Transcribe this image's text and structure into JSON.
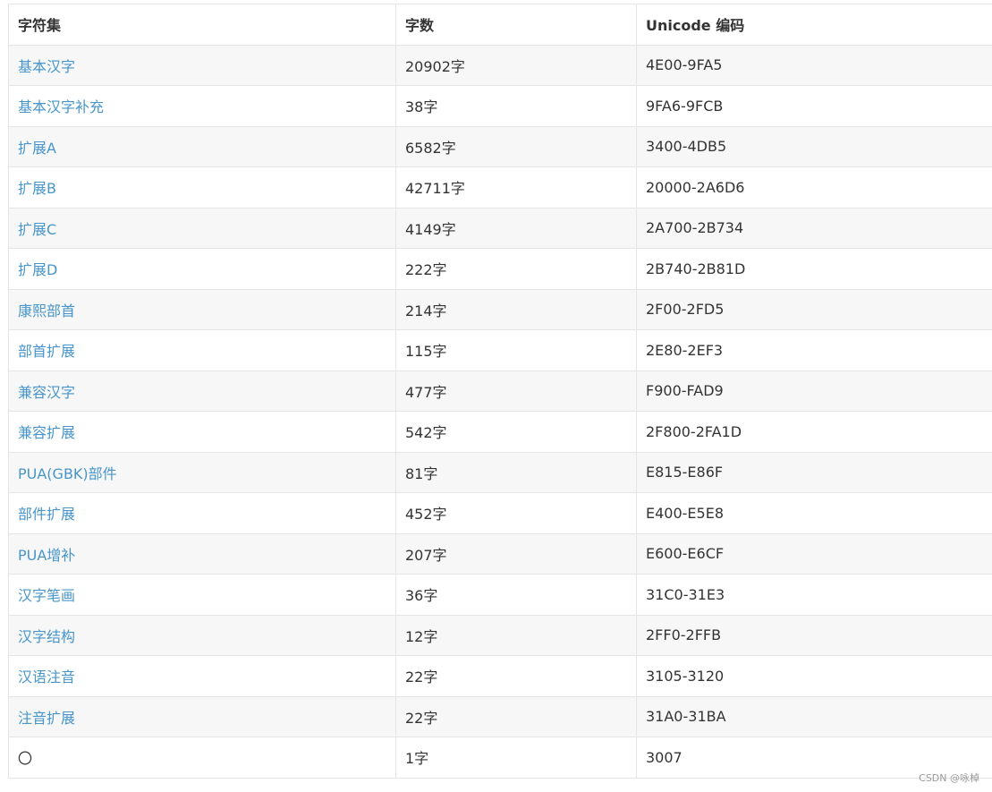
{
  "table": {
    "headers": [
      "字符集",
      "字数",
      "Unicode 编码"
    ],
    "rows": [
      [
        "基本汉字",
        "20902字",
        "4E00-9FA5"
      ],
      [
        "基本汉字补充",
        "38字",
        "9FA6-9FCB"
      ],
      [
        "扩展A",
        "6582字",
        "3400-4DB5"
      ],
      [
        "扩展B",
        "42711字",
        "20000-2A6D6"
      ],
      [
        "扩展C",
        "4149字",
        "2A700-2B734"
      ],
      [
        "扩展D",
        "222字",
        "2B740-2B81D"
      ],
      [
        "康熙部首",
        "214字",
        "2F00-2FD5"
      ],
      [
        "部首扩展",
        "115字",
        "2E80-2EF3"
      ],
      [
        "兼容汉字",
        "477字",
        "F900-FAD9"
      ],
      [
        "兼容扩展",
        "542字",
        "2F800-2FA1D"
      ],
      [
        "PUA(GBK)部件",
        "81字",
        "E815-E86F"
      ],
      [
        "部件扩展",
        "452字",
        "E400-E5E8"
      ],
      [
        "PUA增补",
        "207字",
        "E600-E6CF"
      ],
      [
        "汉字笔画",
        "36字",
        "31C0-31E3"
      ],
      [
        "汉字结构",
        "12字",
        "2FF0-2FFB"
      ],
      [
        "汉语注音",
        "22字",
        "3105-3120"
      ],
      [
        "注音扩展",
        "22字",
        "31A0-31BA"
      ],
      [
        "〇",
        "1字",
        "3007"
      ]
    ]
  },
  "watermark": "CSDN @咏棹",
  "colors": {
    "link": "#4795c9",
    "text": "#333333",
    "stripe": "#f7f7f7",
    "border": "#e5e5e5"
  }
}
